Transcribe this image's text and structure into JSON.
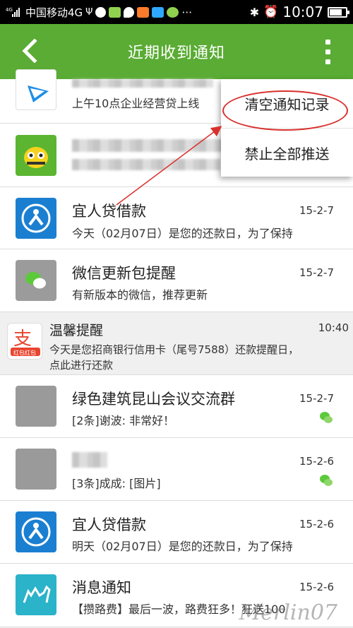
{
  "status_bar": {
    "network": "4G",
    "carrier": "中国移动4G",
    "time": "10:07"
  },
  "app_bar": {
    "title": "近期收到通知",
    "back_icon": "chevron-left-icon",
    "more_icon": "more-vertical-icon",
    "color": "#5aac34"
  },
  "menu": {
    "items": [
      {
        "label": "清空通知记录"
      },
      {
        "label": "禁止全部推送"
      }
    ],
    "highlight_color": "#d9302c"
  },
  "notifications": [
    {
      "title": "",
      "sub": "上午10点企业经营贷上线",
      "date": "",
      "icon": "play-video-app-icon"
    },
    {
      "title": "",
      "sub": "",
      "date": "",
      "icon": "bee-mascot-app-icon",
      "blurred": true
    },
    {
      "title": "宜人贷借款",
      "sub": "今天（02月07日）是您的还款日，为了保持",
      "date": "15-2-7",
      "icon": "yirendai-icon"
    },
    {
      "title": "微信更新包提醒",
      "sub": "有新版本的微信，推荐更新",
      "date": "15-2-7",
      "icon": "wechat-icon"
    },
    {
      "title": "温馨提醒",
      "sub": "今天是您招商银行信用卡（尾号7588）还款提醒日，",
      "sub2": "点此进行还款",
      "date": "10:40",
      "icon": "alipay-icon",
      "icon_caption": "红包红包"
    },
    {
      "title": "绿色建筑昆山会议交流群",
      "sub": "[2条]谢波: 非常好！",
      "date": "15-2-7",
      "icon": "gray-avatar-icon"
    },
    {
      "title": "",
      "sub": "[3条]成成: [图片]",
      "date": "15-2-6",
      "icon": "gray-avatar-icon",
      "blurred": true
    },
    {
      "title": "宜人贷借款",
      "sub": "明天（02月07日）是您的还款日，为了保持",
      "date": "15-2-6",
      "icon": "yirendai-icon"
    },
    {
      "title": "消息通知",
      "sub": "【攒路费】最后一波，路费狂多！狂送100",
      "date": "15-2-6",
      "icon": "camel-icon"
    }
  ],
  "watermark": "Merlin07"
}
